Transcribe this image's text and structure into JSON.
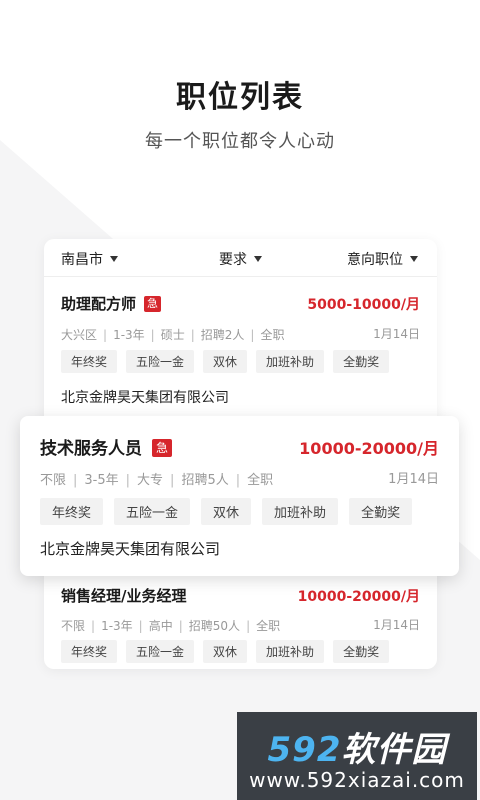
{
  "hero": {
    "title": "职位列表",
    "subtitle": "每一个职位都令人心动"
  },
  "filters": [
    {
      "label": "南昌市"
    },
    {
      "label": "要求"
    },
    {
      "label": "意向职位"
    }
  ],
  "jobs": [
    {
      "title": "助理配方师",
      "urgent": "急",
      "salary": "5000-10000/月",
      "meta": [
        "大兴区",
        "1-3年",
        "硕士",
        "招聘2人",
        "全职"
      ],
      "date": "1月14日",
      "tags": [
        "年终奖",
        "五险一金",
        "双休",
        "加班补助",
        "全勤奖"
      ],
      "company": "北京金牌昊天集团有限公司"
    },
    {
      "title": "技术服务人员",
      "urgent": "急",
      "salary": "10000-20000/月",
      "meta": [
        "不限",
        "3-5年",
        "大专",
        "招聘5人",
        "全职"
      ],
      "date": "1月14日",
      "tags": [
        "年终奖",
        "五险一金",
        "双休",
        "加班补助",
        "全勤奖"
      ],
      "company": "北京金牌昊天集团有限公司"
    },
    {
      "title": "销售经理/业务经理",
      "salary": "10000-20000/月",
      "meta": [
        "不限",
        "1-3年",
        "高中",
        "招聘50人",
        "全职"
      ],
      "date": "1月14日",
      "tags": [
        "年终奖",
        "五险一金",
        "双休",
        "加班补助",
        "全勤奖"
      ]
    }
  ],
  "watermark": {
    "logo_num": "592",
    "logo_text": "软件园",
    "url": "www.592xiazai.com"
  },
  "colors": {
    "accent": "#d6262c",
    "watermark_bg": "#3a3f45",
    "watermark_num": "#4db4f0"
  }
}
